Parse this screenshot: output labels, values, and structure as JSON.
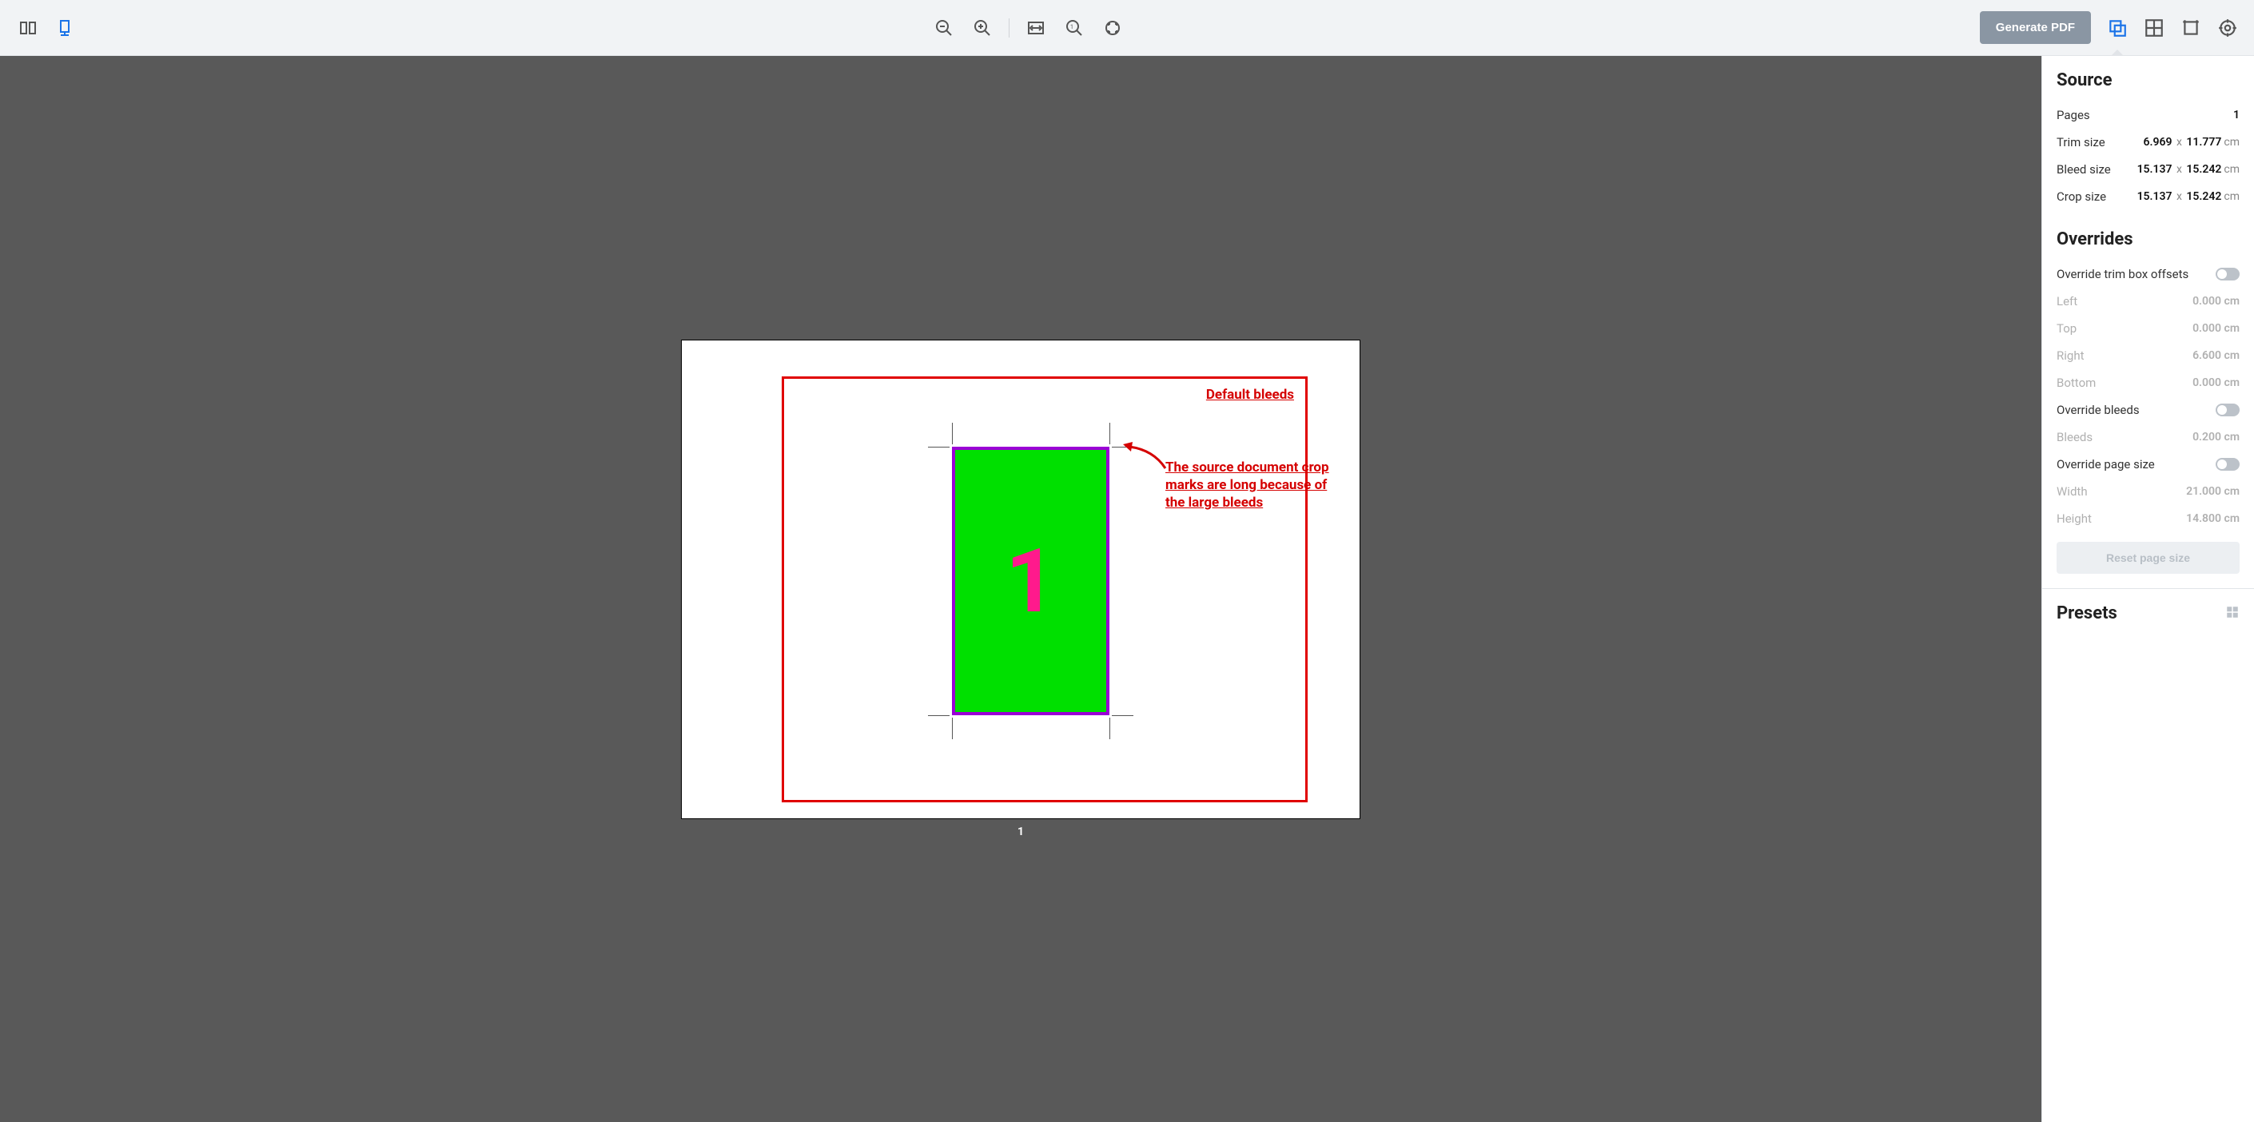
{
  "toolbar": {
    "generate_label": "Generate PDF"
  },
  "canvas": {
    "page_label": "1",
    "page_number": "1",
    "annotation1": "Default bleeds",
    "annotation2": "The source document crop marks are long because of the large bleeds"
  },
  "panel": {
    "source": {
      "title": "Source",
      "pages_label": "Pages",
      "pages_value": "1",
      "trim_label": "Trim size",
      "trim_w": "6.969",
      "trim_h": "11.777",
      "trim_unit": "cm",
      "bleed_label": "Bleed size",
      "bleed_w": "15.137",
      "bleed_h": "15.242",
      "bleed_unit": "cm",
      "crop_label": "Crop size",
      "crop_w": "15.137",
      "crop_h": "15.242",
      "crop_unit": "cm"
    },
    "overrides": {
      "title": "Overrides",
      "trimbox_label": "Override trim box offsets",
      "left_label": "Left",
      "left_val": "0.000",
      "left_unit": "cm",
      "top_label": "Top",
      "top_val": "0.000",
      "top_unit": "cm",
      "right_label": "Right",
      "right_val": "6.600",
      "right_unit": "cm",
      "bottom_label": "Bottom",
      "bottom_val": "0.000",
      "bottom_unit": "cm",
      "bleeds_toggle_label": "Override bleeds",
      "bleeds_label": "Bleeds",
      "bleeds_val": "0.200",
      "bleeds_unit": "cm",
      "pagesize_toggle_label": "Override page size",
      "width_label": "Width",
      "width_val": "21.000",
      "width_unit": "cm",
      "height_label": "Height",
      "height_val": "14.800",
      "height_unit": "cm",
      "reset_label": "Reset page size"
    },
    "presets": {
      "title": "Presets"
    }
  }
}
